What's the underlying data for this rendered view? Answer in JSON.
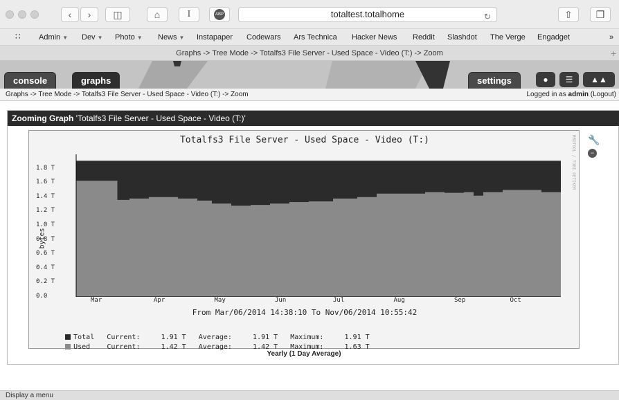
{
  "browser": {
    "url": "totaltest.totalhome",
    "tab_title": "Graphs -> Tree Mode -> Totalfs3 File Server - Used Space - Video (T:) -> Zoom",
    "abp_label": "ABP",
    "reader_label": "I",
    "favorites": [
      {
        "label": "Admin",
        "menu": true
      },
      {
        "label": "Dev",
        "menu": true
      },
      {
        "label": "Photo",
        "menu": true
      },
      {
        "label": "News",
        "menu": true
      },
      {
        "label": "Instapaper",
        "menu": false
      },
      {
        "label": "Codewars",
        "menu": false
      },
      {
        "label": "Ars Technica",
        "menu": false
      },
      {
        "label": "Hacker News",
        "menu": false
      },
      {
        "label": "Reddit",
        "menu": false
      },
      {
        "label": "Slashdot",
        "menu": false
      },
      {
        "label": "The Verge",
        "menu": false
      },
      {
        "label": "Engadget",
        "menu": false
      }
    ],
    "status_text": "Display a menu"
  },
  "cacti": {
    "tabs": {
      "console": "console",
      "graphs": "graphs",
      "settings": "settings"
    },
    "breadcrumb": "Graphs -> Tree Mode -> Totalfs3 File Server - Used Space - Video (T:) -> Zoom",
    "login_prefix": "Logged in as",
    "login_user": "admin",
    "logout": "(Logout)"
  },
  "panel": {
    "heading_bold": "Zooming Graph",
    "heading_rest": "'Totalfs3 File Server - Used Space - Video (T:)'",
    "footer": "Yearly (1 Day Average)"
  },
  "chart_data": {
    "type": "area",
    "title": "Totalfs3 File Server - Used Space - Video (T:)",
    "ylabel": "bytes",
    "ylim": [
      0,
      1.91
    ],
    "yticks": [
      "0.0",
      "0.2 T",
      "0.4 T",
      "0.6 T",
      "0.8 T",
      "1.0 T",
      "1.2 T",
      "1.4 T",
      "1.6 T",
      "1.8 T"
    ],
    "ytick_values": [
      0,
      0.2,
      0.4,
      0.6,
      0.8,
      1.0,
      1.2,
      1.4,
      1.6,
      1.8
    ],
    "xticks": [
      "Mar",
      "Apr",
      "May",
      "Jun",
      "Jul",
      "Aug",
      "Sep",
      "Oct"
    ],
    "date_range": "From Mar/06/2014 14:38:10 To Nov/06/2014 10:55:42",
    "series": [
      {
        "name": "Total",
        "color": "#2b2b2b",
        "values": [
          1.91,
          1.91,
          1.91,
          1.91,
          1.91,
          1.91,
          1.91,
          1.91,
          1.91
        ]
      },
      {
        "name": "Used",
        "color": "#8a8a8a",
        "x_frac": [
          0.0,
          0.08,
          0.085,
          0.11,
          0.15,
          0.21,
          0.25,
          0.28,
          0.32,
          0.36,
          0.4,
          0.44,
          0.48,
          0.53,
          0.58,
          0.62,
          0.67,
          0.72,
          0.76,
          0.8,
          0.82,
          0.84,
          0.88,
          0.92,
          0.96,
          1.0
        ],
        "values": [
          1.63,
          1.63,
          1.36,
          1.38,
          1.4,
          1.38,
          1.35,
          1.31,
          1.28,
          1.29,
          1.31,
          1.33,
          1.34,
          1.38,
          1.4,
          1.45,
          1.45,
          1.47,
          1.46,
          1.47,
          1.42,
          1.47,
          1.5,
          1.5,
          1.47,
          1.42
        ]
      }
    ],
    "legend": [
      {
        "name": "Total",
        "current_label": "Current:",
        "current": "1.91 T",
        "average_label": "Average:",
        "average": "1.91 T",
        "maximum_label": "Maximum:",
        "maximum": "1.91 T",
        "color": "#2b2b2b"
      },
      {
        "name": "Used",
        "current_label": "Current:",
        "current": "1.42 T",
        "average_label": "Average:",
        "average": "1.42 T",
        "maximum_label": "Maximum:",
        "maximum": "1.63 T",
        "color": "#8a8a8a"
      }
    ],
    "side_text": "RRDTOOL / TOBI OETIKER"
  }
}
